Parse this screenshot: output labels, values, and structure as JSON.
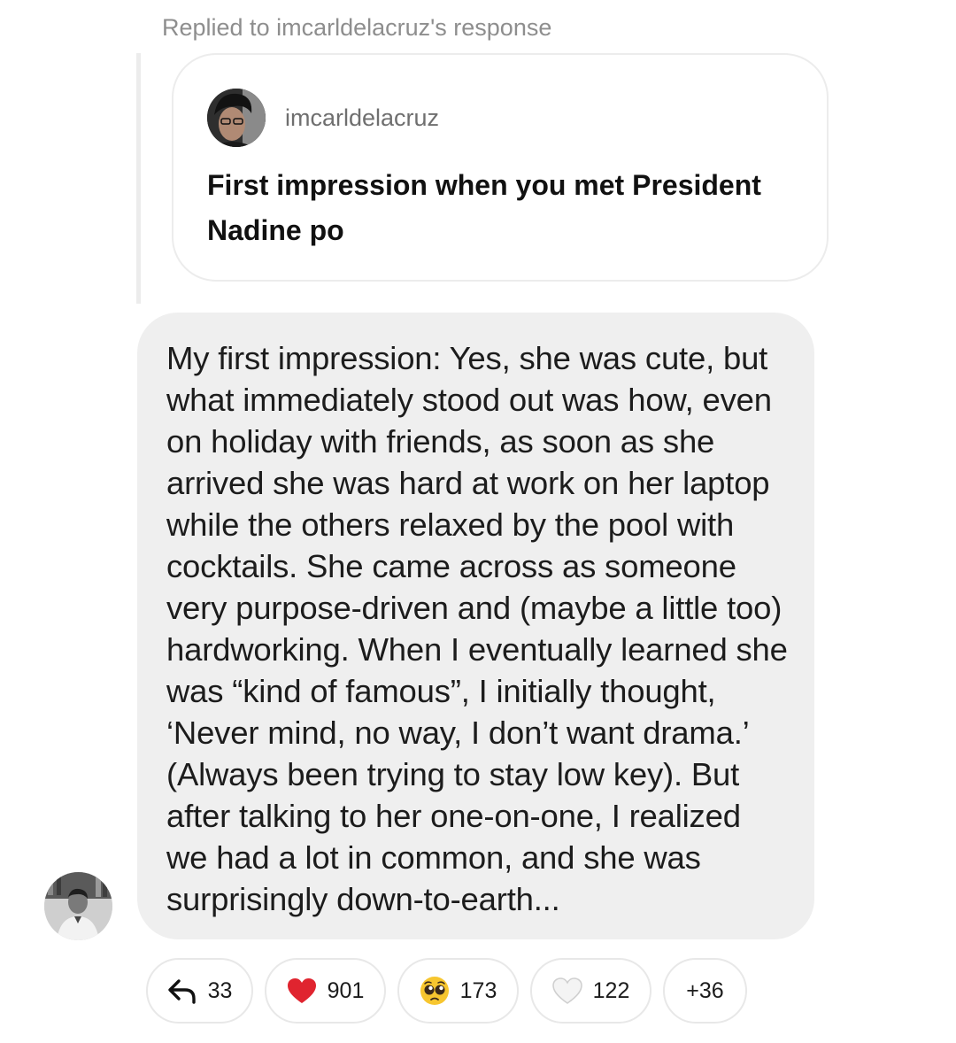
{
  "reply_context": {
    "label": "Replied to imcarldelacruz's response"
  },
  "quoted_message": {
    "username": "imcarldelacruz",
    "text": "First impression when you met President Nadine po"
  },
  "message": {
    "text": "My first impression: Yes, she was cute, but what immediately stood out was how, even on holiday with friends, as soon as she arrived she was hard at work on her laptop while the others relaxed by the pool with cocktails. She came across as someone very purpose-driven and (maybe a little too) hardworking. When I eventually learned she was “kind of famous”, I initially thought, ‘Never mind, no way, I don’t want drama.’ (Always been trying to stay low key). But after talking to her one-on-one, I realized we had a lot in common, and she was surprisingly down-to-earth..."
  },
  "reactions": [
    {
      "icon": "reply-arrow-icon",
      "count": "33"
    },
    {
      "icon": "red-heart-icon",
      "count": "901",
      "color": "#e0242f"
    },
    {
      "icon": "pleading-face-icon",
      "count": "173",
      "color": "#f7c62f"
    },
    {
      "icon": "white-heart-icon",
      "count": "122",
      "color": "#efefef"
    },
    {
      "icon": "more-reactions",
      "count": "+36"
    }
  ]
}
